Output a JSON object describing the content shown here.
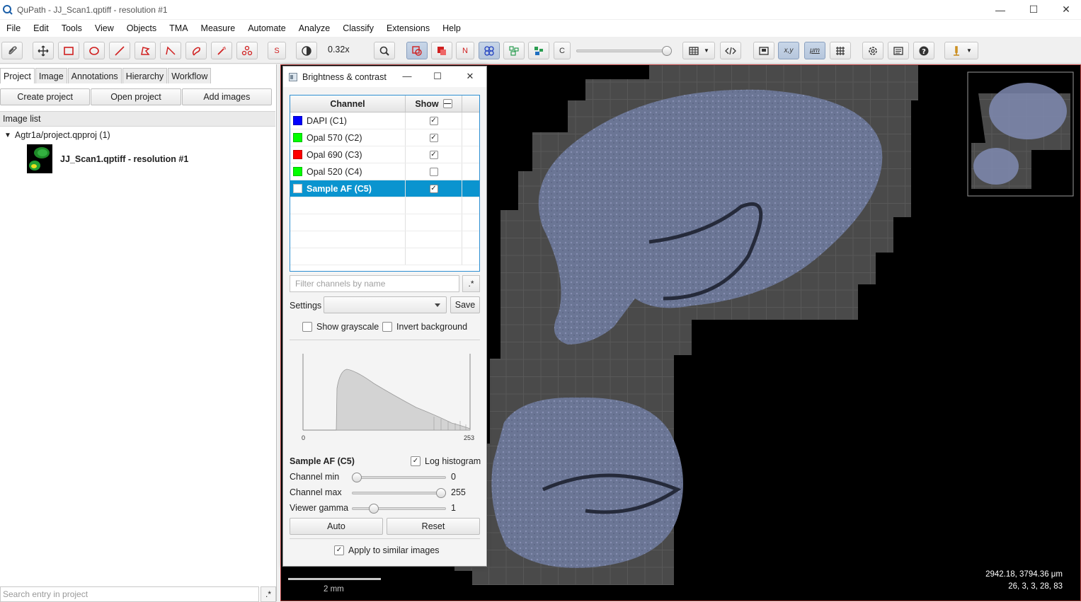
{
  "window": {
    "title": "QuPath - JJ_Scan1.qptiff - resolution #1"
  },
  "menu": [
    "File",
    "Edit",
    "Tools",
    "View",
    "Objects",
    "TMA",
    "Measure",
    "Automate",
    "Analyze",
    "Classify",
    "Extensions",
    "Help"
  ],
  "toolbar": {
    "zoom": "0.32x",
    "btn_s": "S",
    "btn_n": "N",
    "btn_c": "C",
    "btn_xy": "x,y",
    "btn_um": "μm"
  },
  "left": {
    "tabs": [
      "Project",
      "Image",
      "Annotations",
      "Hierarchy",
      "Workflow"
    ],
    "buttons": [
      "Create project",
      "Open project",
      "Add images"
    ],
    "image_list_header": "Image list",
    "project_node": "Agtr1a/project.qpproj (1)",
    "entry": "JJ_Scan1.qptiff - resolution #1",
    "search_placeholder": "Search entry in project",
    "regex": ".*"
  },
  "dialog": {
    "title": "Brightness & contrast",
    "col_channel": "Channel",
    "col_show": "Show",
    "channels": [
      {
        "name": "DAPI (C1)",
        "color": "#0000ff",
        "show": true
      },
      {
        "name": "Opal 570 (C2)",
        "color": "#00ff00",
        "show": true
      },
      {
        "name": "Opal 690 (C3)",
        "color": "#ff0000",
        "show": true
      },
      {
        "name": "Opal 520 (C4)",
        "color": "#00ff00",
        "show": false
      },
      {
        "name": "Sample AF (C5)",
        "color": "#ffffff",
        "show": true
      }
    ],
    "filter_placeholder": "Filter channels by name",
    "filter_regex": ".*",
    "settings_label": "Settings",
    "save": "Save",
    "show_grayscale": "Show grayscale",
    "invert_background": "Invert background",
    "hist_min": "0",
    "hist_max": "253",
    "selected_channel": "Sample AF (C5)",
    "log_histogram": "Log histogram",
    "channel_min_label": "Channel min",
    "channel_min": "0",
    "channel_min_frac": 0.0,
    "channel_max_label": "Channel max",
    "channel_max": "255",
    "channel_max_frac": 1.0,
    "gamma_label": "Viewer gamma",
    "gamma": "1",
    "gamma_frac": 0.2,
    "auto": "Auto",
    "reset": "Reset",
    "apply_similar": "Apply to similar images"
  },
  "viewer": {
    "scale": "2 mm",
    "coord_line1": "2942.18, 3794.36 μm",
    "coord_line2": "26, 3, 3, 28, 83"
  }
}
